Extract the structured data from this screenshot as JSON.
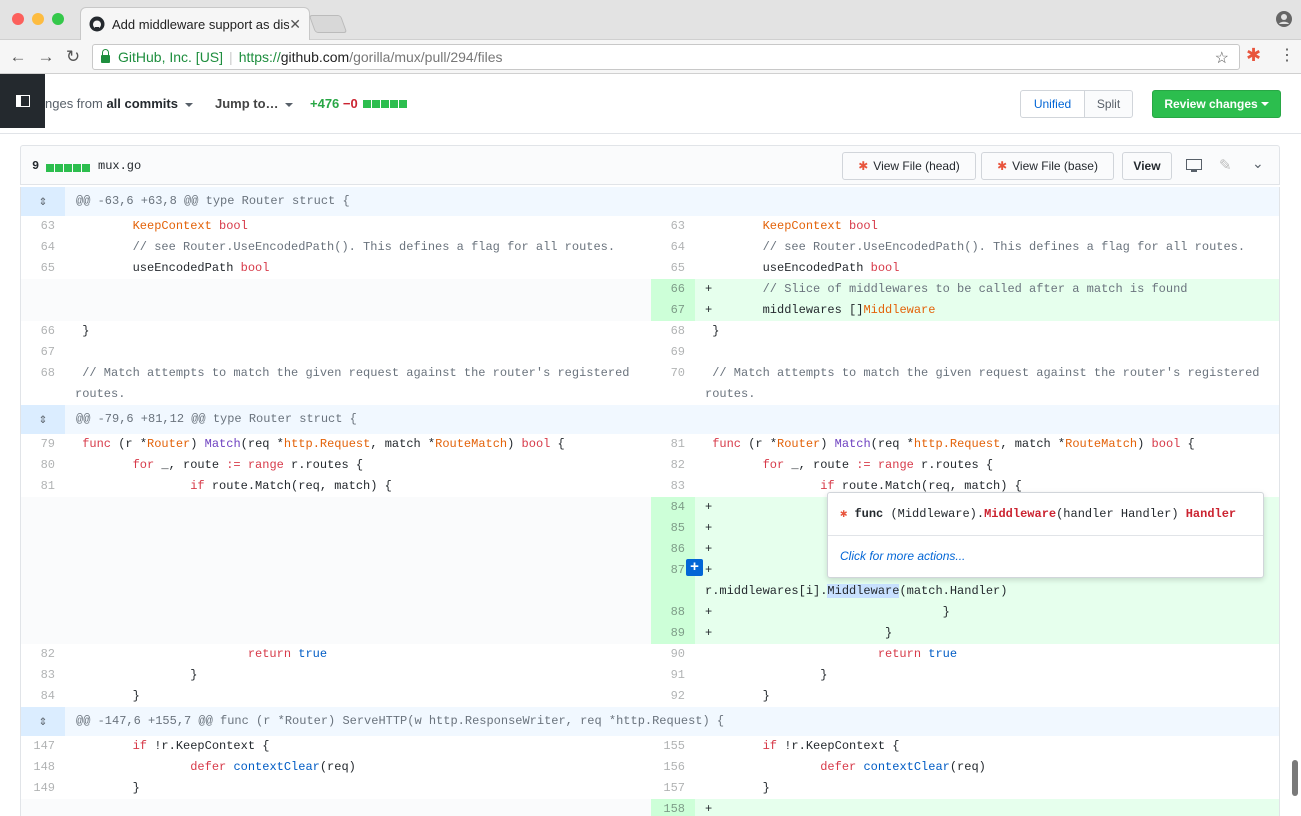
{
  "browser": {
    "tab_title": "Add middleware support as dis",
    "url_org": "GitHub, Inc. [US]",
    "url_scheme": "https://",
    "url_host": "github.com",
    "url_path": "/gorilla/mux/pull/294/files"
  },
  "toolbar": {
    "changes_prefix": "nges from",
    "changes_scope": "all commits",
    "jump_label": "Jump to…",
    "additions": "+476",
    "deletions": "−0",
    "unified_label": "Unified",
    "split_label": "Split",
    "review_label": "Review changes"
  },
  "file": {
    "count": "9",
    "name": "mux.go",
    "view_head_label": "View File (head)",
    "view_base_label": "View File (base)",
    "view_label": "View"
  },
  "hunks": [
    "@@ -63,6 +63,8 @@ type Router struct {",
    "@@ -79,6 +81,12 @@ type Router struct {",
    "@@ -147,6 +155,7 @@ func (r *Router) ServeHTTP(w http.ResponseWriter, req *http.Request) {"
  ],
  "popup": {
    "func_kw": "func",
    "receiver": "(Middleware).",
    "method": "Middleware",
    "params": "(handler Handler)",
    "ret": "Handler",
    "more": "Click for more actions..."
  },
  "lines": {
    "l63": "63",
    "l64": "64",
    "l65": "65",
    "l66": "66",
    "l67": "67",
    "l68": "68",
    "r63": "63",
    "r64": "64",
    "r65": "65",
    "r66": "66",
    "r67": "67",
    "r68": "68",
    "r69": "69",
    "r70": "70",
    "l79": "79",
    "l80": "80",
    "l81": "81",
    "l82": "82",
    "l83": "83",
    "l84": "84",
    "r81": "81",
    "r82": "82",
    "r83": "83",
    "r84": "84",
    "r85": "85",
    "r86": "86",
    "r87": "87",
    "r88": "88",
    "r89": "89",
    "r90": "90",
    "r91": "91",
    "r92": "92",
    "l147": "147",
    "l148": "148",
    "l149": "149",
    "r155": "155",
    "r156": "156",
    "r157": "157",
    "r158": "158"
  }
}
